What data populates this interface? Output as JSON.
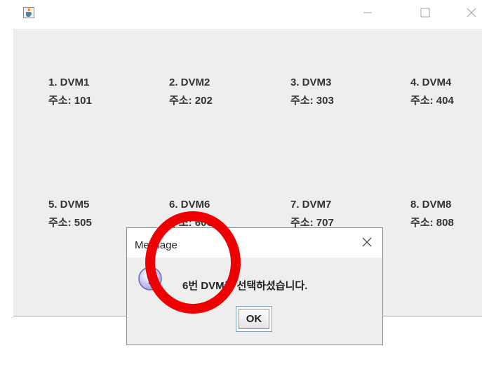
{
  "window": {
    "icon": "java-cup-icon",
    "controls": [
      "minimize-icon",
      "maximize-icon",
      "close-icon"
    ]
  },
  "dvms": [
    {
      "name": "1. DVM1",
      "address": "주소: 101"
    },
    {
      "name": "2. DVM2",
      "address": "주소: 202"
    },
    {
      "name": "3. DVM3",
      "address": "주소: 303"
    },
    {
      "name": "4. DVM4",
      "address": "주소: 404"
    },
    {
      "name": "5. DVM5",
      "address": "주소: 505"
    },
    {
      "name": "6. DVM6",
      "address": "주소: 606"
    },
    {
      "name": "7. DVM7",
      "address": "주소: 707"
    },
    {
      "name": "8. DVM8",
      "address": "주소: 808"
    }
  ],
  "dialog": {
    "title": "Message",
    "message": "6번 DVM을 선택하셨습니다.",
    "ok_label": "OK",
    "icon": "info-icon"
  },
  "annotation": {
    "color": "#ee0000"
  }
}
